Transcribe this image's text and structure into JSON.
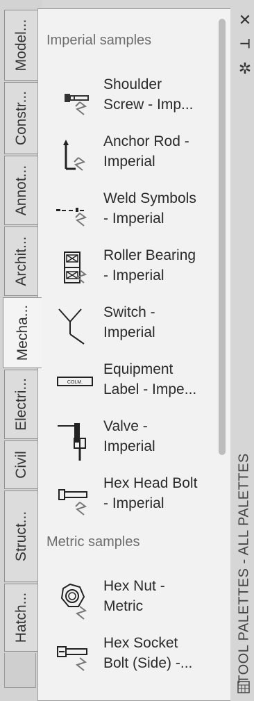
{
  "tabs": [
    {
      "label": "Model..."
    },
    {
      "label": "Constr..."
    },
    {
      "label": "Annot..."
    },
    {
      "label": "Archit..."
    },
    {
      "label": "Mecha...",
      "active": true
    },
    {
      "label": "Electri..."
    },
    {
      "label": "Civil"
    },
    {
      "label": "Struct..."
    },
    {
      "label": "Hatch..."
    }
  ],
  "sections": {
    "imperial": "Imperial samples",
    "metric": "Metric samples"
  },
  "tools": [
    {
      "label": "Shoulder\nScrew - Imp...",
      "icon": "shoulder-screw-icon"
    },
    {
      "label": "Anchor Rod -\nImperial",
      "icon": "anchor-rod-icon"
    },
    {
      "label": "Weld Symbols\n- Imperial",
      "icon": "weld-symbol-icon"
    },
    {
      "label": "Roller Bearing\n- Imperial",
      "icon": "roller-bearing-icon"
    },
    {
      "label": "Switch -\nImperial",
      "icon": "switch-icon"
    },
    {
      "label": "Equipment\nLabel - Impe...",
      "icon": "equipment-label-icon"
    },
    {
      "label": "Valve -\nImperial",
      "icon": "valve-icon"
    },
    {
      "label": "Hex Head Bolt\n- Imperial",
      "icon": "hex-head-bolt-icon"
    },
    {
      "label": "Hex Nut -\nMetric",
      "icon": "hex-nut-icon"
    },
    {
      "label": "Hex Socket\nBolt (Side) -...",
      "icon": "hex-socket-bolt-icon"
    }
  ],
  "equipment_tag": "COLM.",
  "strip": {
    "title": "TOOL PALETTES - ALL PALETTES",
    "close": "✕",
    "autohide": "⊣",
    "properties": "✲"
  }
}
